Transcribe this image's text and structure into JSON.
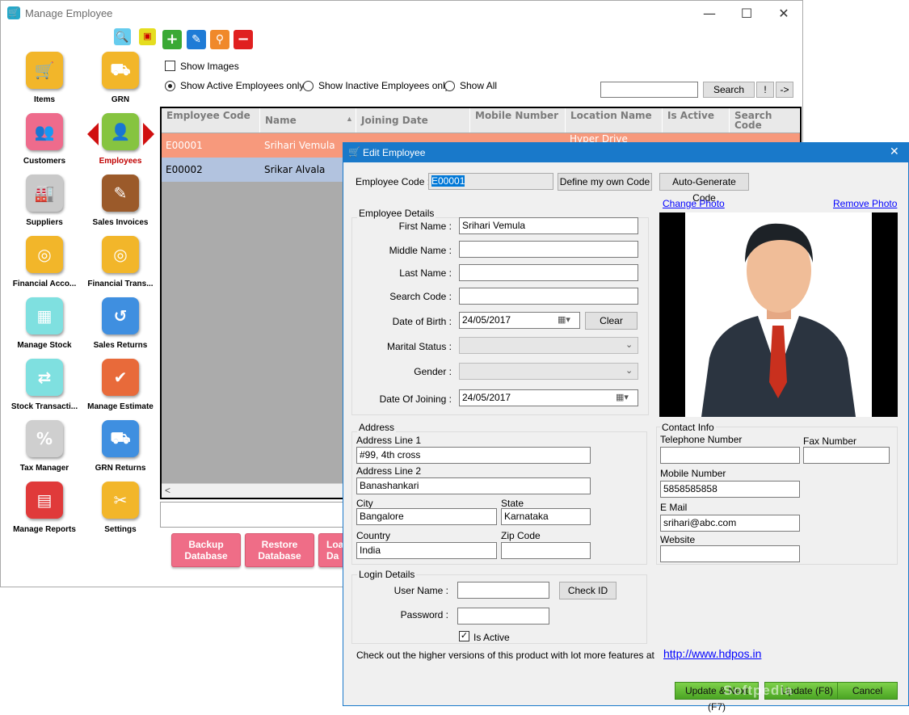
{
  "main_window": {
    "title": "Manage Employee",
    "controls": {
      "minimize": "—",
      "maximize": "☐",
      "close": "✕"
    }
  },
  "nav": {
    "items": [
      {
        "label": "Items",
        "icon": "cart-icon",
        "color": "#f2b62a"
      },
      {
        "label": "GRN",
        "icon": "truck-icon",
        "color": "#f2b62a"
      },
      {
        "label": "Customers",
        "icon": "people-icon",
        "color": "#ee6b8c"
      },
      {
        "label": "Employees",
        "icon": "employee-icon",
        "color": "#86c440"
      },
      {
        "label": "Suppliers",
        "icon": "factory-icon",
        "color": "#c9c9c9"
      },
      {
        "label": "Sales Invoices",
        "icon": "invoice-icon",
        "color": "#9b5a2a"
      },
      {
        "label": "Financial Acco...",
        "icon": "coins-icon",
        "color": "#f2b62a"
      },
      {
        "label": "Financial Trans...",
        "icon": "coins-transfer-icon",
        "color": "#f2b62a"
      },
      {
        "label": "Manage Stock",
        "icon": "boxes-icon",
        "color": "#7fe0e0"
      },
      {
        "label": "Sales Returns",
        "icon": "return-cart-icon",
        "color": "#3f8fe0"
      },
      {
        "label": "Stock Transacti...",
        "icon": "stock-transfer-icon",
        "color": "#7fe0e0"
      },
      {
        "label": "Manage Estimate",
        "icon": "estimate-icon",
        "color": "#e86a3a"
      },
      {
        "label": "Tax Manager",
        "icon": "percent-icon",
        "color": "#cfcfcf"
      },
      {
        "label": "GRN Returns",
        "icon": "truck-return-icon",
        "color": "#3f8fe0"
      },
      {
        "label": "Manage Reports",
        "icon": "reports-icon",
        "color": "#e03a3a"
      },
      {
        "label": "Settings",
        "icon": "tools-icon",
        "color": "#f2b62a"
      }
    ],
    "active_label_color": "#c00000"
  },
  "toolbar": {
    "show_images": "Show Images",
    "radio_active": "Show Active Employees only",
    "radio_inactive": "Show Inactive Employees only",
    "radio_all": "Show All",
    "search_value": "",
    "search_button": "Search",
    "excl_button": "!",
    "next_button": "->"
  },
  "grid": {
    "columns": [
      {
        "label": "Employee Code"
      },
      {
        "label": "Name"
      },
      {
        "label": "Joining Date"
      },
      {
        "label": "Mobile Number"
      },
      {
        "label": "Location Name"
      },
      {
        "label": "Is Active"
      },
      {
        "label": "Search Code"
      }
    ],
    "rows": [
      {
        "code": "E00001",
        "name": "Srihari Vemula",
        "location": "Hyper Drive"
      },
      {
        "code": "E00002",
        "name": "Srikar Alvala",
        "location": ""
      }
    ],
    "scroll_left": "<"
  },
  "bottom_buttons": {
    "backup": "Backup Database",
    "restore": "Restore Database",
    "load": "Load Da"
  },
  "dialog": {
    "title": "Edit Employee",
    "close": "✕",
    "employee_code_label": "Employee Code :",
    "employee_code_value": "E00001",
    "define_code_button": "Define my own Code",
    "auto_code_button": "Auto-Generate Code",
    "change_photo": "Change Photo",
    "remove_photo": "Remove Photo",
    "details": {
      "title": "Employee Details",
      "first_name_label": "First Name :",
      "first_name": "Srihari Vemula",
      "middle_name_label": "Middle Name :",
      "middle_name": "",
      "last_name_label": "Last Name :",
      "last_name": "",
      "search_code_label": "Search Code :",
      "search_code": "",
      "dob_label": "Date of Birth :",
      "dob": "24/05/2017",
      "clear_button": "Clear",
      "marital_label": "Marital Status :",
      "marital": "",
      "gender_label": "Gender :",
      "gender": "",
      "doj_label": "Date Of Joining :",
      "doj": "24/05/2017"
    },
    "address": {
      "title": "Address",
      "line1_label": "Address Line 1",
      "line1": "#99, 4th cross",
      "line2_label": "Address Line 2",
      "line2": "Banashankari",
      "city_label": "City",
      "city": "Bangalore",
      "state_label": "State",
      "state": "Karnataka",
      "country_label": "Country",
      "country": "India",
      "zip_label": "Zip Code",
      "zip": ""
    },
    "contact": {
      "title": "Contact Info",
      "telephone_label": "Telephone Number",
      "telephone": "",
      "fax_label": "Fax Number",
      "fax": "",
      "mobile_label": "Mobile Number",
      "mobile": "5858585858",
      "email_label": "E Mail",
      "email": "srihari@abc.com",
      "website_label": "Website",
      "website": ""
    },
    "login": {
      "title": "Login Details",
      "user_label": "User Name :",
      "user": "",
      "check_button": "Check ID",
      "password_label": "Password :",
      "password": "",
      "is_active_label": "Is Active"
    },
    "promo_text": "Check out the higher versions of this product with lot more features at",
    "promo_link": "http://www.hdpos.in",
    "update_next_button": "Update & Next (F7)",
    "update_button": "Update (F8)",
    "cancel_button": "Cancel"
  },
  "watermark": "Softpedia"
}
